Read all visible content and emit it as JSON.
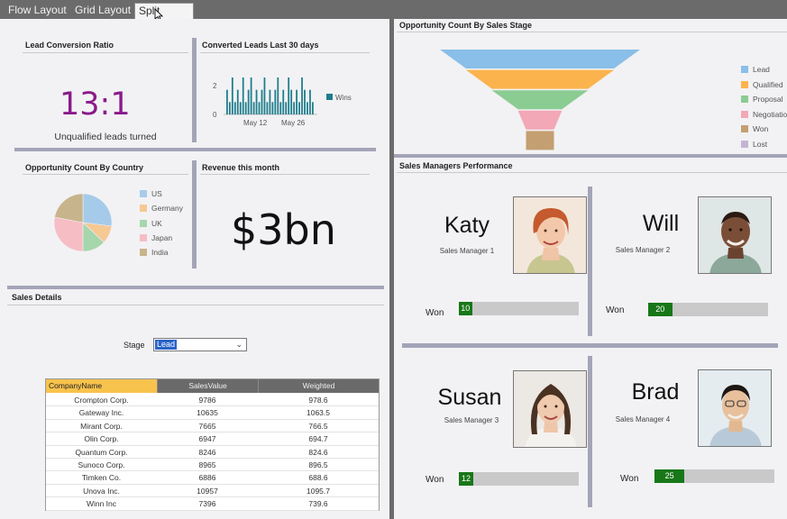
{
  "tabs": [
    "Flow Layout",
    "Grid Layout",
    "Split Layout"
  ],
  "kpi": {
    "lead_title": "Lead Conversion Ratio",
    "ratio": "13:1",
    "ratio_caption": "Unqualified leads turned",
    "converted_title": "Converted Leads Last 30 days",
    "country_title": "Opportunity Count By Country",
    "revenue_title": "Revenue this month",
    "revenue_value": "$3bn"
  },
  "sales_details": {
    "title": "Sales Details",
    "stage_label": "Stage",
    "stage_value": "Lead",
    "columns": [
      "CompanyName",
      "SalesValue",
      "Weighted"
    ],
    "rows": [
      [
        "Crompton Corp.",
        "9786",
        "978.6"
      ],
      [
        "Gateway Inc.",
        "10635",
        "1063.5"
      ],
      [
        "Mirant Corp.",
        "7665",
        "766.5"
      ],
      [
        "Olin Corp.",
        "6947",
        "694.7"
      ],
      [
        "Quantum Corp.",
        "8246",
        "824.6"
      ],
      [
        "Sunoco Corp.",
        "8965",
        "896.5"
      ],
      [
        "Timken Co.",
        "6886",
        "688.6"
      ],
      [
        "Unova Inc.",
        "10957",
        "1095.7"
      ],
      [
        "Winn Inc",
        "7396",
        "739.6"
      ]
    ]
  },
  "funnel": {
    "title": "Opportunity Count By Sales Stage"
  },
  "managers_title": "Sales Managers Performance",
  "managers": [
    {
      "name": "Katy",
      "role": "Sales Manager 1",
      "won_label": "Won",
      "won": "10",
      "won_fraction": 0.11
    },
    {
      "name": "Will",
      "role": "Sales Manager 2",
      "won_label": "Won",
      "won": "20",
      "won_fraction": 0.2
    },
    {
      "name": "Susan",
      "role": "Sales Manager 3",
      "won_label": "Won",
      "won": "12",
      "won_fraction": 0.12
    },
    {
      "name": "Brad",
      "role": "Sales Manager 4",
      "won_label": "Won",
      "won": "25",
      "won_fraction": 0.25
    }
  ],
  "colors": {
    "accent_green": "#187718",
    "ratio_purple": "#8a1a8a",
    "bar_teal": "#1e7d8c"
  },
  "chart_data": [
    {
      "type": "bar",
      "ylim": [
        0,
        3
      ],
      "yticks": [
        "0",
        "2"
      ],
      "xticks": [
        "May 12",
        "May 26"
      ],
      "legend": [
        "Wins"
      ],
      "legend_position": "right",
      "series": [
        {
          "name": "Wins",
          "values": [
            2,
            1,
            3,
            1,
            2,
            1,
            3,
            1,
            2,
            3,
            1,
            2,
            1,
            2,
            3,
            1,
            2,
            1,
            2,
            3,
            1,
            2,
            1,
            3,
            2,
            1,
            2,
            1,
            3,
            2,
            1,
            2,
            1
          ]
        }
      ]
    },
    {
      "type": "pie",
      "legend": [
        "US",
        "Germany",
        "UK",
        "Japan",
        "India"
      ],
      "legend_position": "right",
      "values": [
        27,
        10,
        13,
        28,
        22
      ],
      "colors": [
        "#a6cbea",
        "#f6c894",
        "#a6d6ab",
        "#f6bdc4",
        "#c8b48c"
      ]
    },
    {
      "type": "bar",
      "subtype": "funnel",
      "legend": [
        "Lead",
        "Qualified",
        "Proposal",
        "Negotiation",
        "Won",
        "Lost"
      ],
      "legend_position": "right",
      "colors": [
        "#89bfe8",
        "#fbb44d",
        "#8bcc92",
        "#f2a8b6",
        "#c49f72",
        "#c4b4d3"
      ],
      "values": [
        100,
        74,
        48,
        22,
        14
      ]
    }
  ]
}
